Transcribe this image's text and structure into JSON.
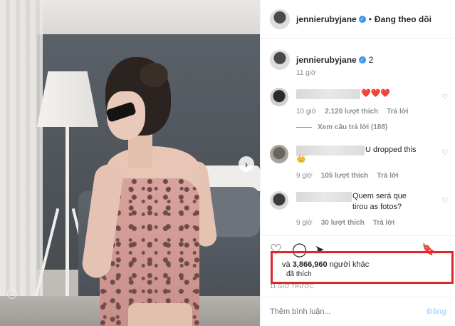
{
  "post": {
    "username": "jennierubyjane",
    "follow_status": "Đang theo dõi",
    "dot": "•",
    "caption_number": "2",
    "caption_time": "11 giờ",
    "carousel_arrow": "›"
  },
  "comments": [
    {
      "text": "❤️❤️❤️",
      "time": "10 giờ",
      "likes": "2.120 lượt thích",
      "reply": "Trả lời",
      "view_replies": "Xem câu trả lời (188)"
    },
    {
      "text": "U dropped this",
      "emoji": "👑",
      "time": "9 giờ",
      "likes": "105 lượt thích",
      "reply": "Trả lời"
    },
    {
      "text": "Quem será que tirou as fotos?",
      "time": "9 giờ",
      "likes": "30 lượt thích",
      "reply": "Trả lời"
    }
  ],
  "actions": {
    "like_icon": "♡",
    "comment_icon": "◯",
    "share_icon": "➤",
    "save_icon": "🔖"
  },
  "likes": {
    "prefix": "và",
    "count": "3,866,960",
    "suffix": "người khác",
    "liked": "đã thích"
  },
  "timestamp": "11 GIỜ TRƯỚC",
  "comment_box": {
    "placeholder": "Thêm bình luận...",
    "post": "Đăng"
  },
  "colors": {
    "highlight": "#e0262b",
    "verified": "#3897f0"
  }
}
